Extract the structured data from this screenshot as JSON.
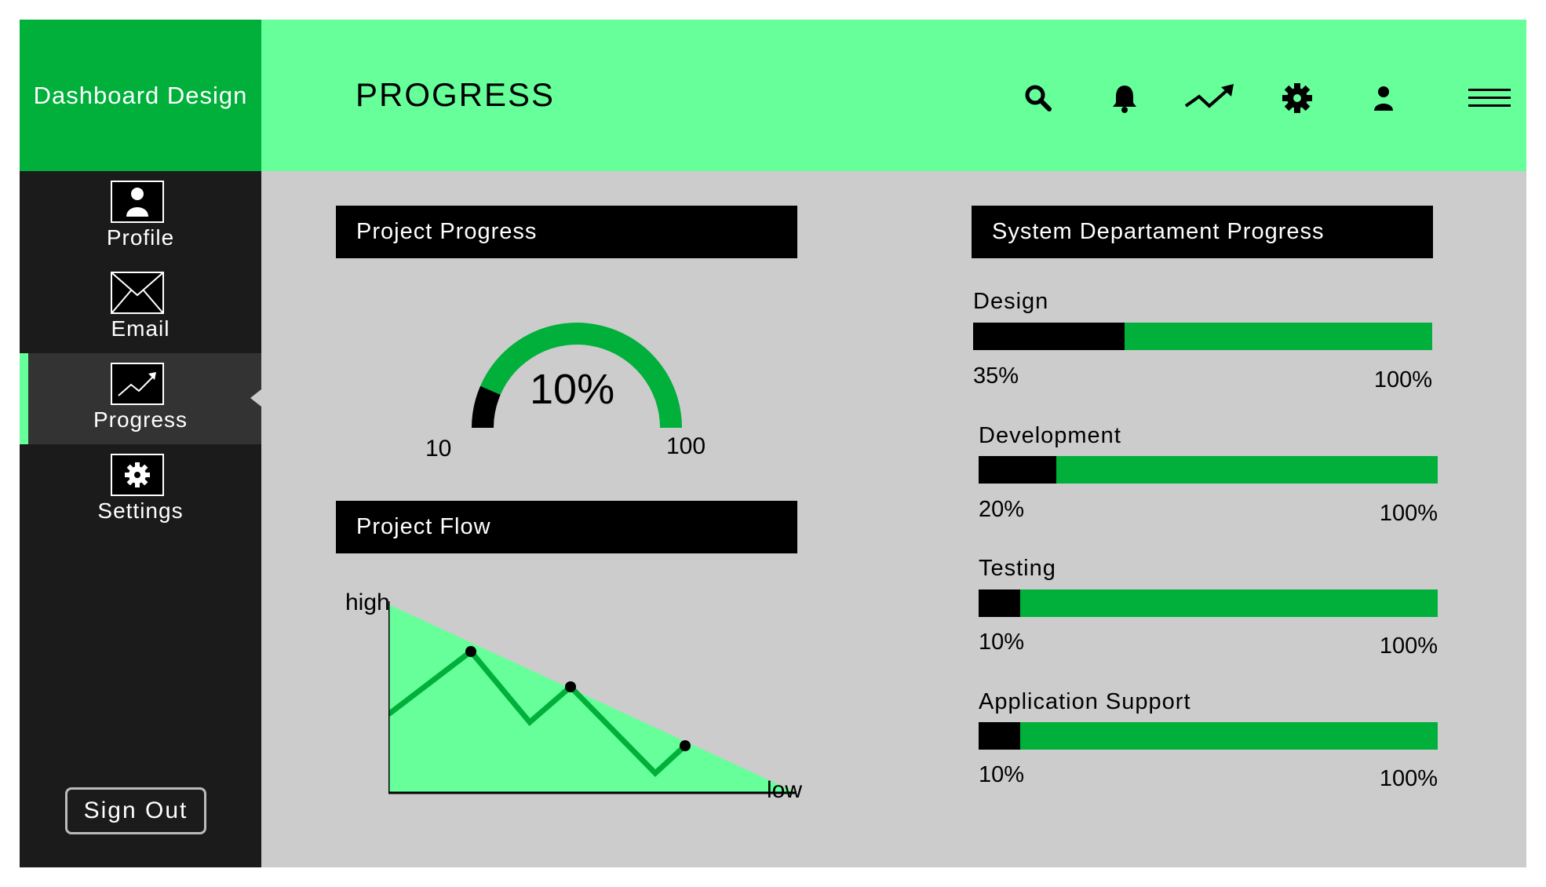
{
  "brand": {
    "title": "Dashboard Design"
  },
  "header": {
    "title": "PROGRESS",
    "icons": [
      "search-icon",
      "bell-icon",
      "trend-icon",
      "gear-icon",
      "user-icon",
      "menu-icon"
    ]
  },
  "sidebar": {
    "items": [
      {
        "label": "Profile",
        "icon": "user-icon",
        "active": false
      },
      {
        "label": "Email",
        "icon": "mail-icon",
        "active": false
      },
      {
        "label": "Progress",
        "icon": "chart-icon",
        "active": true
      },
      {
        "label": "Settings",
        "icon": "gear-icon",
        "active": false
      }
    ],
    "signout_label": "Sign Out"
  },
  "project_progress": {
    "title": "Project Progress",
    "gauge_value_text": "10%",
    "min_label": "10",
    "max_label": "100",
    "fraction": 0.1
  },
  "project_flow": {
    "title": "Project Flow",
    "y_label": "high",
    "x_label": "low"
  },
  "system_progress": {
    "title": "System Departament Progress",
    "items": [
      {
        "label": "Design",
        "percent_text": "35%",
        "max_text": "100%",
        "fraction": 0.33
      },
      {
        "label": "Development",
        "percent_text": "20%",
        "max_text": "100%",
        "fraction": 0.17
      },
      {
        "label": "Testing",
        "percent_text": "10%",
        "max_text": "100%",
        "fraction": 0.09
      },
      {
        "label": "Application Support",
        "percent_text": "10%",
        "max_text": "100%",
        "fraction": 0.09
      }
    ]
  },
  "colors": {
    "accent_dark": "#00b03b",
    "accent_light": "#66ff99",
    "sidebar_bg": "#1b1b1b",
    "content_bg": "#cccccc"
  }
}
